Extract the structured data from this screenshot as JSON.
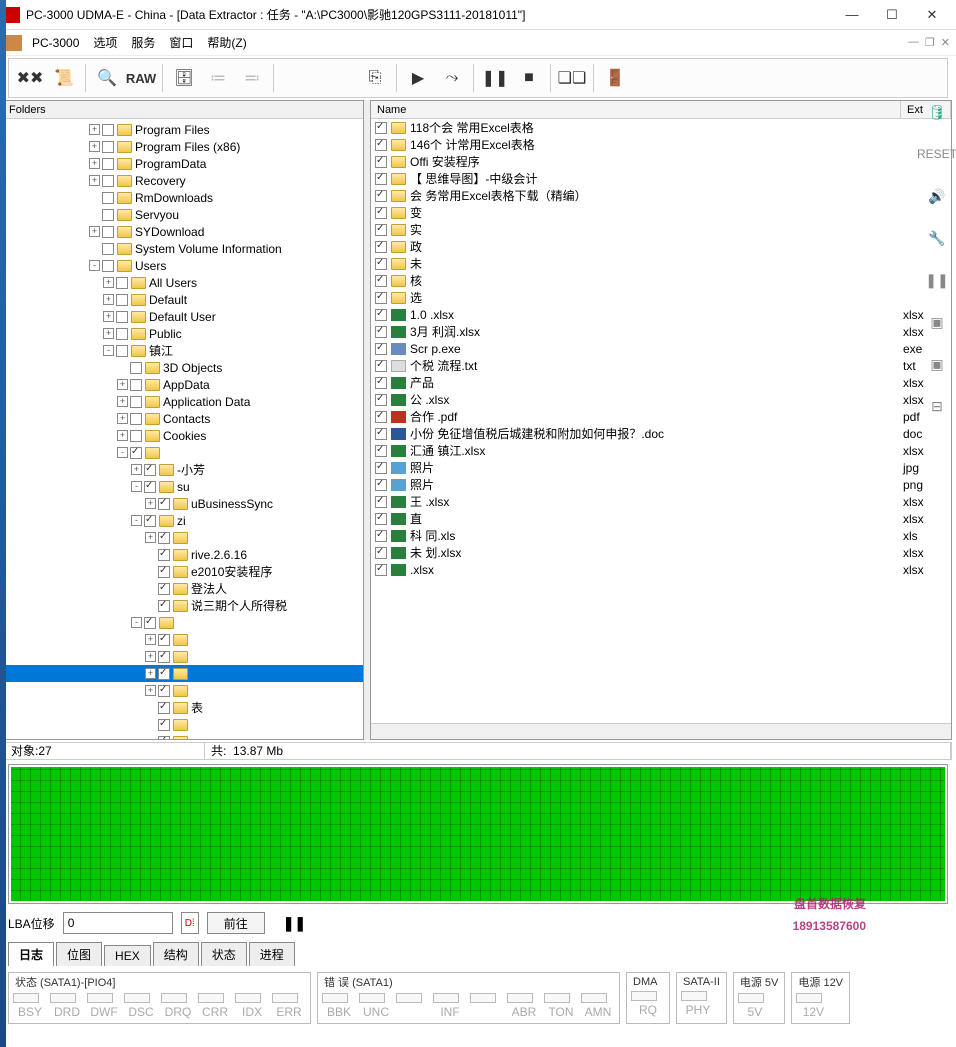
{
  "window": {
    "title": "PC-3000 UDMA-E - China - [Data Extractor : 任务 - \"A:\\PC3000\\影驰120GPS3111-20181011\"]"
  },
  "menu": {
    "app": "PC-3000",
    "items": [
      "选项",
      "服务",
      "窗口",
      "帮助(Z)"
    ]
  },
  "toolbar": {
    "raw": "RAW"
  },
  "folders_header": "Folders",
  "tree": [
    {
      "indent": 6,
      "exp": "+",
      "cb": false,
      "label": "Program Files"
    },
    {
      "indent": 6,
      "exp": "+",
      "cb": false,
      "label": "Program Files (x86)"
    },
    {
      "indent": 6,
      "exp": "+",
      "cb": false,
      "label": "ProgramData"
    },
    {
      "indent": 6,
      "exp": "+",
      "cb": false,
      "label": "Recovery"
    },
    {
      "indent": 6,
      "exp": "",
      "cb": false,
      "label": "RmDownloads"
    },
    {
      "indent": 6,
      "exp": "",
      "cb": false,
      "label": "Servyou"
    },
    {
      "indent": 6,
      "exp": "+",
      "cb": false,
      "label": "SYDownload"
    },
    {
      "indent": 6,
      "exp": "",
      "cb": false,
      "label": "System Volume Information"
    },
    {
      "indent": 6,
      "exp": "-",
      "cb": false,
      "label": "Users"
    },
    {
      "indent": 7,
      "exp": "+",
      "cb": false,
      "label": "All Users"
    },
    {
      "indent": 7,
      "exp": "+",
      "cb": false,
      "label": "Default"
    },
    {
      "indent": 7,
      "exp": "+",
      "cb": false,
      "label": "Default User"
    },
    {
      "indent": 7,
      "exp": "+",
      "cb": false,
      "label": "Public"
    },
    {
      "indent": 7,
      "exp": "-",
      "cb": false,
      "label": "镇江"
    },
    {
      "indent": 8,
      "exp": "",
      "cb": false,
      "label": "3D Objects"
    },
    {
      "indent": 8,
      "exp": "+",
      "cb": false,
      "label": "AppData"
    },
    {
      "indent": 8,
      "exp": "+",
      "cb": false,
      "label": "Application Data"
    },
    {
      "indent": 8,
      "exp": "+",
      "cb": false,
      "label": "Contacts"
    },
    {
      "indent": 8,
      "exp": "+",
      "cb": false,
      "label": "Cookies"
    },
    {
      "indent": 8,
      "exp": "-",
      "cb": true,
      "label": ""
    },
    {
      "indent": 9,
      "exp": "+",
      "cb": true,
      "label": "   -小芳"
    },
    {
      "indent": 9,
      "exp": "-",
      "cb": true,
      "label": "su"
    },
    {
      "indent": 10,
      "exp": "+",
      "cb": true,
      "label": "   uBusinessSync"
    },
    {
      "indent": 9,
      "exp": "-",
      "cb": true,
      "label": "zi"
    },
    {
      "indent": 10,
      "exp": "+",
      "cb": true,
      "label": ""
    },
    {
      "indent": 10,
      "exp": "",
      "cb": true,
      "label": "   rive.2.6.16"
    },
    {
      "indent": 10,
      "exp": "",
      "cb": true,
      "label": "   e2010安装程序"
    },
    {
      "indent": 10,
      "exp": "",
      "cb": true,
      "label": "   登法人"
    },
    {
      "indent": 10,
      "exp": "",
      "cb": true,
      "label": "   说三期个人所得税"
    },
    {
      "indent": 9,
      "exp": "-",
      "cb": true,
      "label": ""
    },
    {
      "indent": 10,
      "exp": "+",
      "cb": true,
      "label": ""
    },
    {
      "indent": 10,
      "exp": "+",
      "cb": true,
      "label": ""
    },
    {
      "indent": 10,
      "exp": "+",
      "cb": true,
      "label": "",
      "selected": true
    },
    {
      "indent": 10,
      "exp": "+",
      "cb": true,
      "label": ""
    },
    {
      "indent": 10,
      "exp": "",
      "cb": true,
      "label": "   表"
    },
    {
      "indent": 10,
      "exp": "",
      "cb": true,
      "label": ""
    },
    {
      "indent": 10,
      "exp": "",
      "cb": true,
      "label": ""
    },
    {
      "indent": 10,
      "exp": "+",
      "cb": true,
      "label": ""
    },
    {
      "indent": 10,
      "exp": "",
      "cb": true,
      "label": ""
    }
  ],
  "file_columns": {
    "name": "Name",
    "ext": "Ext"
  },
  "files": [
    {
      "icon": "folder",
      "name": "118个会    常用Excel表格",
      "ext": ""
    },
    {
      "icon": "folder",
      "name": "146个    计常用Excel表格",
      "ext": ""
    },
    {
      "icon": "folder",
      "name": "Offi    安装程序",
      "ext": ""
    },
    {
      "icon": "folder",
      "name": "【    思维导图】-中级会计",
      "ext": ""
    },
    {
      "icon": "folder",
      "name": "会    务常用Excel表格下载（精编）",
      "ext": ""
    },
    {
      "icon": "folder",
      "name": "变",
      "ext": ""
    },
    {
      "icon": "folder",
      "name": "实",
      "ext": ""
    },
    {
      "icon": "folder",
      "name": "政",
      "ext": ""
    },
    {
      "icon": "folder",
      "name": "未",
      "ext": ""
    },
    {
      "icon": "folder",
      "name": "核",
      "ext": ""
    },
    {
      "icon": "folder",
      "name": "选",
      "ext": ""
    },
    {
      "icon": "xls",
      "name": "1.0    .xlsx",
      "ext": "xlsx"
    },
    {
      "icon": "xls",
      "name": "3月    利润.xlsx",
      "ext": "xlsx"
    },
    {
      "icon": "exe",
      "name": "Scr    p.exe",
      "ext": "exe"
    },
    {
      "icon": "txt",
      "name": "个税    流程.txt",
      "ext": "txt"
    },
    {
      "icon": "xls",
      "name": "产品",
      "ext": "xlsx"
    },
    {
      "icon": "xls",
      "name": "公    .xlsx",
      "ext": "xlsx"
    },
    {
      "icon": "pdf",
      "name": "合作    .pdf",
      "ext": "pdf"
    },
    {
      "icon": "doc",
      "name": "小份    免征增值税后城建税和附加如何申报？.doc",
      "ext": "doc"
    },
    {
      "icon": "xls",
      "name": "汇通    镇江.xlsx",
      "ext": "xlsx"
    },
    {
      "icon": "jpg",
      "name": "照片",
      "ext": "jpg"
    },
    {
      "icon": "png",
      "name": "照片",
      "ext": "png"
    },
    {
      "icon": "xls",
      "name": "王    .xlsx",
      "ext": "xlsx"
    },
    {
      "icon": "xls",
      "name": "直",
      "ext": "xlsx"
    },
    {
      "icon": "xls",
      "name": "科    同.xls",
      "ext": "xls"
    },
    {
      "icon": "xls",
      "name": "未    划.xlsx",
      "ext": "xlsx"
    },
    {
      "icon": "xls",
      "name": "    .xlsx",
      "ext": "xlsx"
    }
  ],
  "status": {
    "objects_label": "对象:",
    "objects_value": "27",
    "total_label": "共:",
    "total_value": "13.87 Mb"
  },
  "lba": {
    "label": "LBA位移",
    "value": "0",
    "goto": "前往",
    "pause": "❚❚"
  },
  "tabs": [
    "日志",
    "位图",
    "HEX",
    "结构",
    "状态",
    "进程"
  ],
  "active_tab": 0,
  "bottom_groups": {
    "state": {
      "title": "状态 (SATA1)-[PIO4]",
      "leds": [
        "BSY",
        "DRD",
        "DWF",
        "DSC",
        "DRQ",
        "CRR",
        "IDX",
        "ERR"
      ]
    },
    "error": {
      "title": "错 误 (SATA1)",
      "leds": [
        "BBK",
        "UNC",
        "",
        "INF",
        "",
        "ABR",
        "TON",
        "AMN"
      ]
    },
    "dma": {
      "title": "DMA",
      "leds": [
        "RQ"
      ]
    },
    "sata2": {
      "title": "SATA-II",
      "leds": [
        "PHY"
      ]
    },
    "pwr5": {
      "title": "电源 5V",
      "leds": [
        "5V"
      ]
    },
    "pwr12": {
      "title": "电源 12V",
      "leds": [
        "12V"
      ]
    }
  },
  "side_labels": {
    "reset": "RESET"
  },
  "watermark": {
    "line1": "盘首数据恢复",
    "line2": "18913587600"
  }
}
